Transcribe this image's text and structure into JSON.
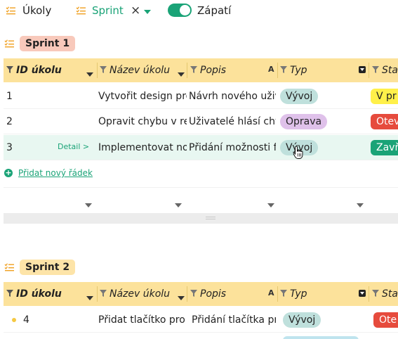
{
  "toolbar": {
    "views_label": "Úkoly",
    "filter_label": "Sprint",
    "clear_symbol": "×",
    "footer_toggle_label": "Zápatí",
    "footer_toggle_on": true
  },
  "groups": [
    {
      "name": "Sprint 1",
      "columns": {
        "id": "ID úkolu",
        "name": "Název úkolu",
        "description": "Popis",
        "description_sort": "A",
        "type": "Typ",
        "status": "Stav"
      },
      "rows": [
        {
          "id": "1",
          "name": "Vytvořit design pro",
          "description": "Návrh nového uživ",
          "type": "Vývoj",
          "status": "V pr"
        },
        {
          "id": "2",
          "name": "Opravit chybu v reg",
          "description": "Uživatelé hlásí chy",
          "type": "Oprava",
          "status": "Otev"
        },
        {
          "id": "3",
          "name": "Implementovat nov",
          "description": "Přidání možnosti fi",
          "type": "Vývoj",
          "status": "Zavř",
          "detail_link": "Detail >"
        }
      ],
      "add_row_label": "Přidat nový řádek"
    },
    {
      "name": "Sprint 2",
      "columns": {
        "id": "ID úkolu",
        "name": "Název úkolu",
        "description": "Popis",
        "description_sort": "A",
        "type": "Typ",
        "status": "Stav"
      },
      "rows": [
        {
          "id": "4",
          "name": "Přidat tlačítko pro s",
          "description": "Přidání tlačítka pr",
          "type": "Vývoj",
          "status": "Ote"
        }
      ]
    }
  ],
  "colors": {
    "accent": "#1aa377",
    "header_bg": "#fce29b",
    "sprint1_badge": "#f8c9bb",
    "sprint2_badge": "#fde4a8",
    "type_vyvoj": "#bfe0dc",
    "type_oprava": "#dfc1ea",
    "status_yellow": "#fff04a",
    "status_red": "#e64b3d",
    "status_green": "#1aa377"
  }
}
